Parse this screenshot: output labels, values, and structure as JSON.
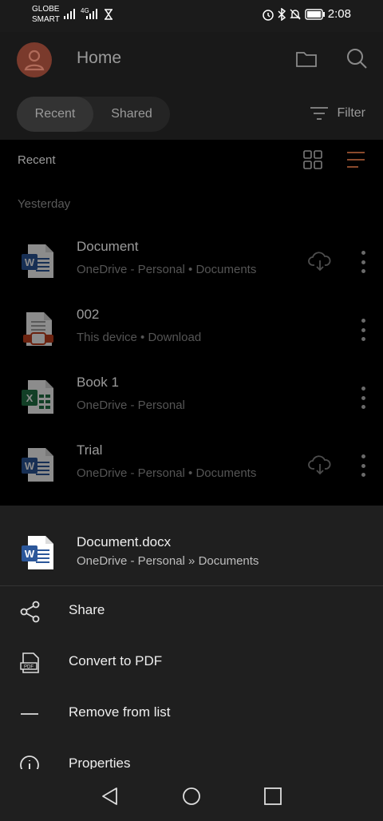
{
  "status_bar": {
    "carrier_line1": "GLOBE",
    "carrier_line2": "SMART",
    "net_label": "4G",
    "time": "2:08"
  },
  "header": {
    "title": "Home",
    "icons": [
      "folder-icon",
      "search-icon"
    ]
  },
  "tabs": {
    "recent": "Recent",
    "shared": "Shared",
    "filter": "Filter"
  },
  "list": {
    "section_title": "Recent",
    "date_group": "Yesterday",
    "files": [
      {
        "name": "Document",
        "location": "OneDrive - Personal • Documents",
        "type": "word",
        "cloud": true
      },
      {
        "name": "002",
        "location": "This device • Download",
        "type": "pdf",
        "cloud": false
      },
      {
        "name": "Book 1",
        "location": "OneDrive - Personal",
        "type": "excel",
        "cloud": false
      },
      {
        "name": "Trial",
        "location": "OneDrive - Personal • Documents",
        "type": "word",
        "cloud": true
      }
    ]
  },
  "sheet": {
    "file_name": "Document.docx",
    "file_location": "OneDrive - Personal » Documents",
    "actions": [
      {
        "label": "Share",
        "icon": "share-icon"
      },
      {
        "label": "Convert to PDF",
        "icon": "pdf-convert-icon"
      },
      {
        "label": "Remove from list",
        "icon": "minus-icon"
      },
      {
        "label": "Properties",
        "icon": "info-icon"
      }
    ]
  },
  "colors": {
    "word_blue": "#2b579a",
    "excel_green": "#217346",
    "pdf_red": "#c43e1c",
    "accent_orange": "#d9662c"
  }
}
